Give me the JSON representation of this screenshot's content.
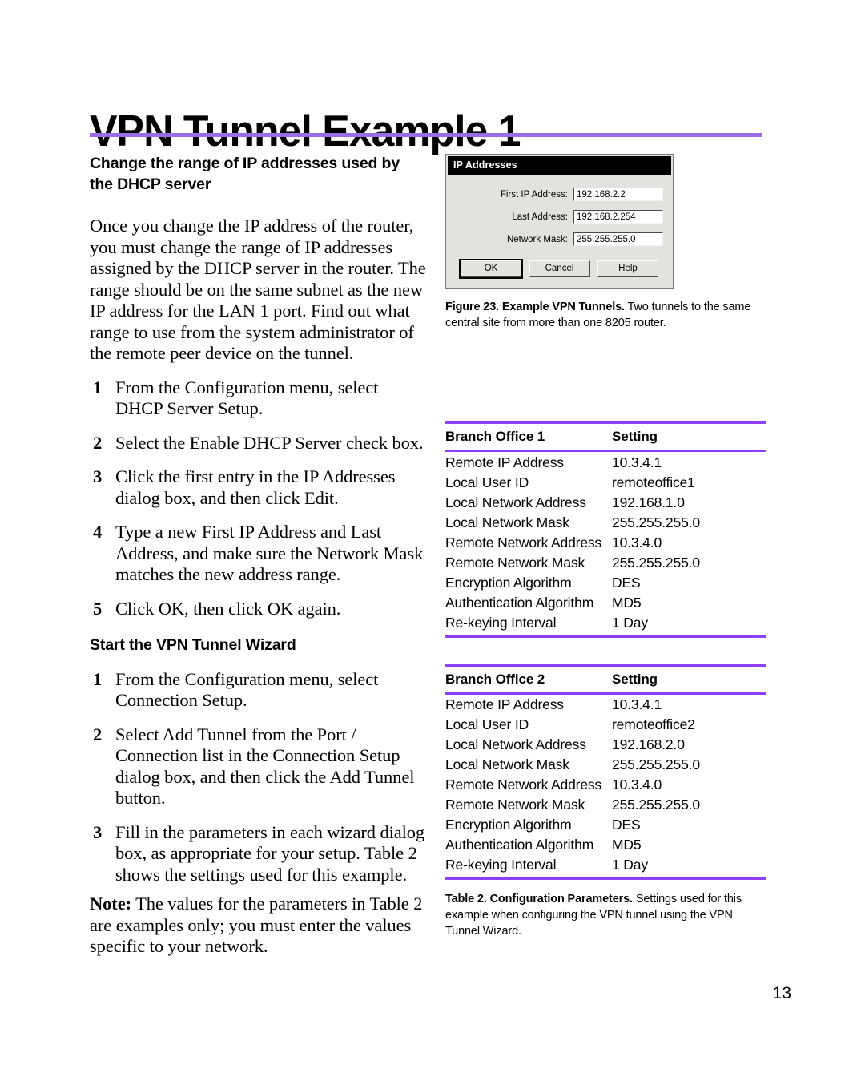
{
  "page": {
    "title": "VPN Tunnel Example 1",
    "page_number": "13",
    "accent_title_rule": "#9d6ae8",
    "accent_table_rule": "#8f3dff"
  },
  "left_column": {
    "heading_1": "Change the range of IP addresses used by the DHCP server",
    "intro_paragraph": "Once you change the IP address of the router, you must change the range of IP addresses assigned by the DHCP server in the router. The range should be on the same subnet as the new IP address for the LAN 1 port. Find out what range to use from the system administrator of the remote peer device on the tunnel.",
    "steps_1": [
      {
        "num": "1",
        "text": "From the Configuration menu, select DHCP Server Setup."
      },
      {
        "num": "2",
        "text": "Select the Enable DHCP Server check box."
      },
      {
        "num": "3",
        "text": "Click the first entry in the IP Addresses dialog box, and then click Edit."
      },
      {
        "num": "4",
        "text": "Type a new First IP Address and Last Address, and make sure the Network Mask matches the new address range."
      },
      {
        "num": "5",
        "text": "Click OK, then click OK again."
      }
    ],
    "heading_2": "Start the VPN Tunnel Wizard",
    "steps_2": [
      {
        "num": "1",
        "text": "From the Configuration menu, select Connection Setup."
      },
      {
        "num": "2",
        "text": "Select Add Tunnel from the Port / Connection list in the Connection Setup dialog box, and then click the Add Tunnel button."
      },
      {
        "num": "3",
        "text": "Fill in the parameters in each wizard dialog box, as appropriate for your setup. Table 2 shows the settings used for this example."
      }
    ],
    "note": {
      "label": "Note:",
      "text": " The values for the parameters in Table 2 are examples only; you must enter the values specific to your network."
    }
  },
  "dialog": {
    "title": "IP Addresses",
    "fields": [
      {
        "label": "First IP Address:",
        "value": "192.168.2.2"
      },
      {
        "label": "Last Address:",
        "value": "192.168.2.254"
      },
      {
        "label": "Network Mask:",
        "value": "255.255.255.0"
      }
    ],
    "buttons": [
      {
        "mnemonic": "O",
        "rest": "K",
        "full": "OK",
        "default": true
      },
      {
        "mnemonic": "C",
        "rest": "ancel",
        "full": "Cancel",
        "default": false
      },
      {
        "mnemonic": "H",
        "rest": "elp",
        "full": "Help",
        "default": false
      }
    ]
  },
  "figure_caption": {
    "bold": "Figure 23. Example VPN Tunnels.",
    "rest": " Two tunnels to the same central site from more than one 8205 router."
  },
  "tables": [
    {
      "headers": [
        "Branch Office 1",
        "Setting"
      ],
      "rows": [
        [
          "Remote IP Address",
          "10.3.4.1"
        ],
        [
          "Local User ID",
          "remoteoffice1"
        ],
        [
          "Local Network Address",
          "192.168.1.0"
        ],
        [
          "Local Network Mask",
          "255.255.255.0"
        ],
        [
          "Remote Network Address",
          "10.3.4.0"
        ],
        [
          "Remote Network Mask",
          "255.255.255.0"
        ],
        [
          "Encryption Algorithm",
          "DES"
        ],
        [
          "Authentication Algorithm",
          "MD5"
        ],
        [
          "Re-keying Interval",
          "1 Day"
        ]
      ]
    },
    {
      "headers": [
        "Branch Office 2",
        "Setting"
      ],
      "rows": [
        [
          "Remote IP Address",
          "10.3.4.1"
        ],
        [
          "Local User ID",
          "remoteoffice2"
        ],
        [
          "Local Network Address",
          "192.168.2.0"
        ],
        [
          "Local Network Mask",
          "255.255.255.0"
        ],
        [
          "Remote Network Address",
          "10.3.4.0"
        ],
        [
          "Remote Network Mask",
          "255.255.255.0"
        ],
        [
          "Encryption Algorithm",
          "DES"
        ],
        [
          "Authentication Algorithm",
          "MD5"
        ],
        [
          "Re-keying Interval",
          "1 Day"
        ]
      ]
    }
  ],
  "table_caption": {
    "bold": "Table 2. Configuration Parameters.",
    "rest": " Settings used for this example when configuring the VPN tunnel using the VPN Tunnel Wizard."
  }
}
